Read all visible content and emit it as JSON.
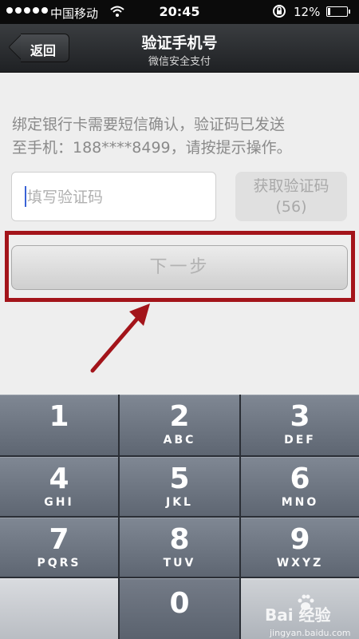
{
  "status_bar": {
    "signal_dots": 5,
    "carrier": "中国移动",
    "wifi_icon": "wifi-icon",
    "time": "20:45",
    "rotation_lock_icon": "rotation-lock-icon",
    "battery_percent": "12%",
    "battery_level": 0.12
  },
  "nav": {
    "back_label": "返回",
    "title": "验证手机号",
    "subtitle": "微信安全支付"
  },
  "content": {
    "info_line1": "绑定银行卡需要短信确认，验证码已发送",
    "info_line2": "至手机：188****8499，请按提示操作。",
    "code_placeholder": "填写验证码",
    "get_code_line1": "获取验证码",
    "get_code_line2": "(56)",
    "next_label": "下一步"
  },
  "annotation": {
    "highlight_color": "#a3141a",
    "arrow_color": "#a3141a"
  },
  "keypad": {
    "keys": [
      {
        "digit": "1",
        "letters": ""
      },
      {
        "digit": "2",
        "letters": "ABC"
      },
      {
        "digit": "3",
        "letters": "DEF"
      },
      {
        "digit": "4",
        "letters": "GHI"
      },
      {
        "digit": "5",
        "letters": "JKL"
      },
      {
        "digit": "6",
        "letters": "MNO"
      },
      {
        "digit": "7",
        "letters": "PQRS"
      },
      {
        "digit": "8",
        "letters": "TUV"
      },
      {
        "digit": "9",
        "letters": "WXYZ"
      },
      {
        "digit": "0",
        "letters": ""
      }
    ]
  },
  "watermark": {
    "brand": "Bai 经验",
    "site": "jingyan.baidu.com"
  }
}
